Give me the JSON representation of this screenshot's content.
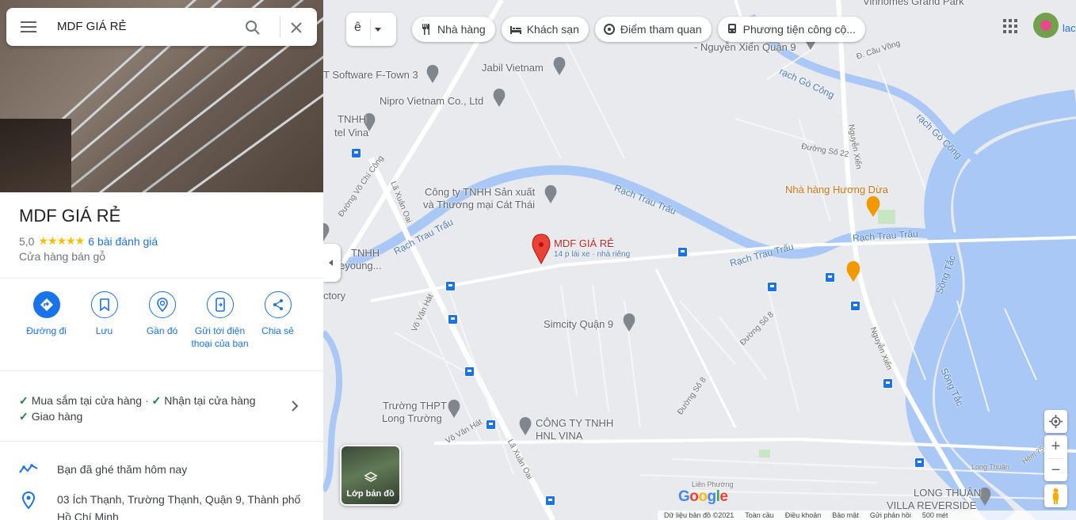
{
  "search": {
    "query": "MDF GIÁ RẺ"
  },
  "place": {
    "name": "MDF GIÁ RẺ",
    "rating": "5,0",
    "stars": "★★★★★",
    "reviews": "6 bài đánh giá",
    "category": "Cửa hàng bán gỗ"
  },
  "actions": [
    {
      "label": "Đường đi",
      "icon": "directions-icon"
    },
    {
      "label": "Lưu",
      "icon": "bookmark-icon"
    },
    {
      "label": "Gần đó",
      "icon": "nearby-icon"
    },
    {
      "label": "Gửi tới điện thoại của bạn",
      "icon": "send-to-phone-icon"
    },
    {
      "label": "Chia sẻ",
      "icon": "share-icon"
    }
  ],
  "features": {
    "line1a": "Mua sắm tại cửa hàng",
    "dot": "·",
    "line1b": "Nhận tại cửa hàng",
    "line2": "Giao hàng"
  },
  "info": {
    "visited": "Bạn đã ghé thăm hôm nay",
    "address": "03 Ích Thạnh, Trường Thạnh, Quận 9, Thành phố Hồ Chí Minh"
  },
  "map": {
    "lang_glyph": "ê",
    "chips": [
      "Nhà hàng",
      "Khách sạn",
      "Điểm tham quan",
      "Phương tiện công cộ..."
    ],
    "account_text": "lac",
    "layers_label": "Lớp bản đồ",
    "marker_title": "MDF GIÁ RẺ",
    "marker_sub": "14 p lái xe · nhà riêng",
    "labels": {
      "vinhomes": "Vinhomes Grand Park",
      "nguyen_xien_q9": "- Nguyễn Xiển Quận 9",
      "software": "T Software F-Town 3",
      "jabil": "Jabil Vietnam",
      "nipro": "Nipro Vietnam Co., Ltd",
      "tnhh_vina_1": "TNHH",
      "tnhh_vina_2": "tel Vina",
      "cat_thai_1": "Công ty TNHH Sản xuất",
      "cat_thai_2": "và Thương mại Cát Thái",
      "rach_trau_trau": "Rạch Trau Trấu",
      "rach_go_cong": "rạch Gò Công",
      "huong_dua": "Nhà hàng Hương Dừa",
      "tnhh_2a": "TNHH",
      "tnhh_2b": "eyoung...",
      "ctory": "ctory",
      "simcity": "Simcity Quận 9",
      "truong_1": "Trường THPT",
      "truong_2": "Long Trường",
      "hnl_1": "CÔNG TY TNHH",
      "hnl_2": "HNL VINA",
      "long_thuan_1": "LONG THUẬN",
      "long_thuan_2": "VILLA REVERSIDE",
      "song_tac": "Sông Tắc",
      "le_xuan_oai": "Lã Xuân Oai",
      "nguyen_xien": "Nguyễn Xiển",
      "vo_chi_cong": "Đường Võ Chí Công",
      "vo_van_hat": "Võ Văn Hát",
      "duong_so_8": "Đường Số 8",
      "duong_so_22": "Đường Số 22",
      "cau_vong": "Đ. Cầu Vồng",
      "lien_phuong": "Liên Phường",
      "long_thuan_rd": "Long Thuận",
      "hem_75": "Hẻm 75"
    },
    "footer": [
      "Dữ liệu bản đồ ©2021",
      "Toàn cầu",
      "Điều khoản",
      "Bảo mật",
      "Gửi phản hồi",
      "500 mét"
    ],
    "google": "Google"
  }
}
